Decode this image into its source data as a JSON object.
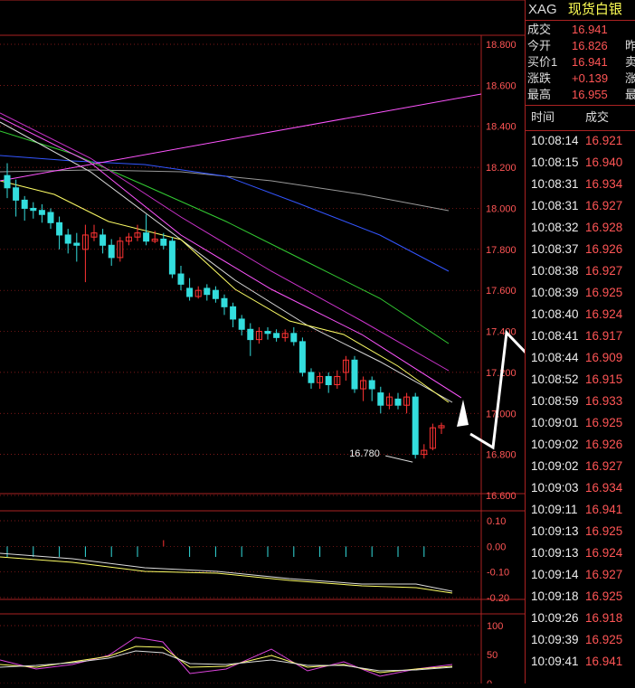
{
  "header": {
    "symbol": "XAG",
    "name": "现货白银"
  },
  "quote": [
    {
      "label": "成交",
      "value": "16.941",
      "extra": ""
    },
    {
      "label": "今开",
      "value": "16.826",
      "extra": "昨"
    },
    {
      "label": "买价1",
      "value": "16.941",
      "extra": "卖"
    },
    {
      "label": "涨跌",
      "value": "+0.139",
      "extra": "涨"
    },
    {
      "label": "最高",
      "value": "16.955",
      "extra": "最"
    }
  ],
  "ticks_header": {
    "time": "时间",
    "price": "成交"
  },
  "ticks": [
    {
      "time": "10:08:14",
      "price": "16.921"
    },
    {
      "time": "10:08:15",
      "price": "16.940"
    },
    {
      "time": "10:08:31",
      "price": "16.934"
    },
    {
      "time": "10:08:31",
      "price": "16.927"
    },
    {
      "time": "10:08:32",
      "price": "16.928"
    },
    {
      "time": "10:08:37",
      "price": "16.926"
    },
    {
      "time": "10:08:38",
      "price": "16.927"
    },
    {
      "time": "10:08:39",
      "price": "16.925"
    },
    {
      "time": "10:08:40",
      "price": "16.924"
    },
    {
      "time": "10:08:41",
      "price": "16.917"
    },
    {
      "time": "10:08:44",
      "price": "16.909"
    },
    {
      "time": "10:08:52",
      "price": "16.915"
    },
    {
      "time": "10:08:59",
      "price": "16.933"
    },
    {
      "time": "10:09:01",
      "price": "16.925"
    },
    {
      "time": "10:09:02",
      "price": "16.926"
    },
    {
      "time": "10:09:02",
      "price": "16.927"
    },
    {
      "time": "10:09:03",
      "price": "16.934"
    },
    {
      "time": "10:09:11",
      "price": "16.941"
    },
    {
      "time": "10:09:13",
      "price": "16.925"
    },
    {
      "time": "10:09:13",
      "price": "16.924"
    },
    {
      "time": "10:09:14",
      "price": "16.927"
    },
    {
      "time": "10:09:18",
      "price": "16.925"
    },
    {
      "time": "10:09:26",
      "price": "16.918"
    },
    {
      "time": "10:09:39",
      "price": "16.925"
    },
    {
      "time": "10:09:41",
      "price": "16.941"
    }
  ],
  "chart": {
    "price_ticks": [
      "18.800",
      "18.600",
      "18.400",
      "18.200",
      "18.000",
      "17.800",
      "17.600",
      "17.400",
      "17.200",
      "17.000",
      "16.800",
      "16.600"
    ],
    "price_range": [
      16.6,
      18.8
    ],
    "low_marker": "16.780",
    "macd_ticks": [
      "0.10",
      "0.00",
      "-0.10",
      "-0.20"
    ],
    "macd_range": [
      -0.2,
      0.1
    ],
    "kdj_ticks": [
      "100",
      "50",
      "0"
    ],
    "kdj_range": [
      0,
      100
    ],
    "colors": {
      "up": "#ff3333",
      "down": "#33dddd",
      "grid": "#aa2222",
      "axis_text": "#ff5555"
    }
  }
}
